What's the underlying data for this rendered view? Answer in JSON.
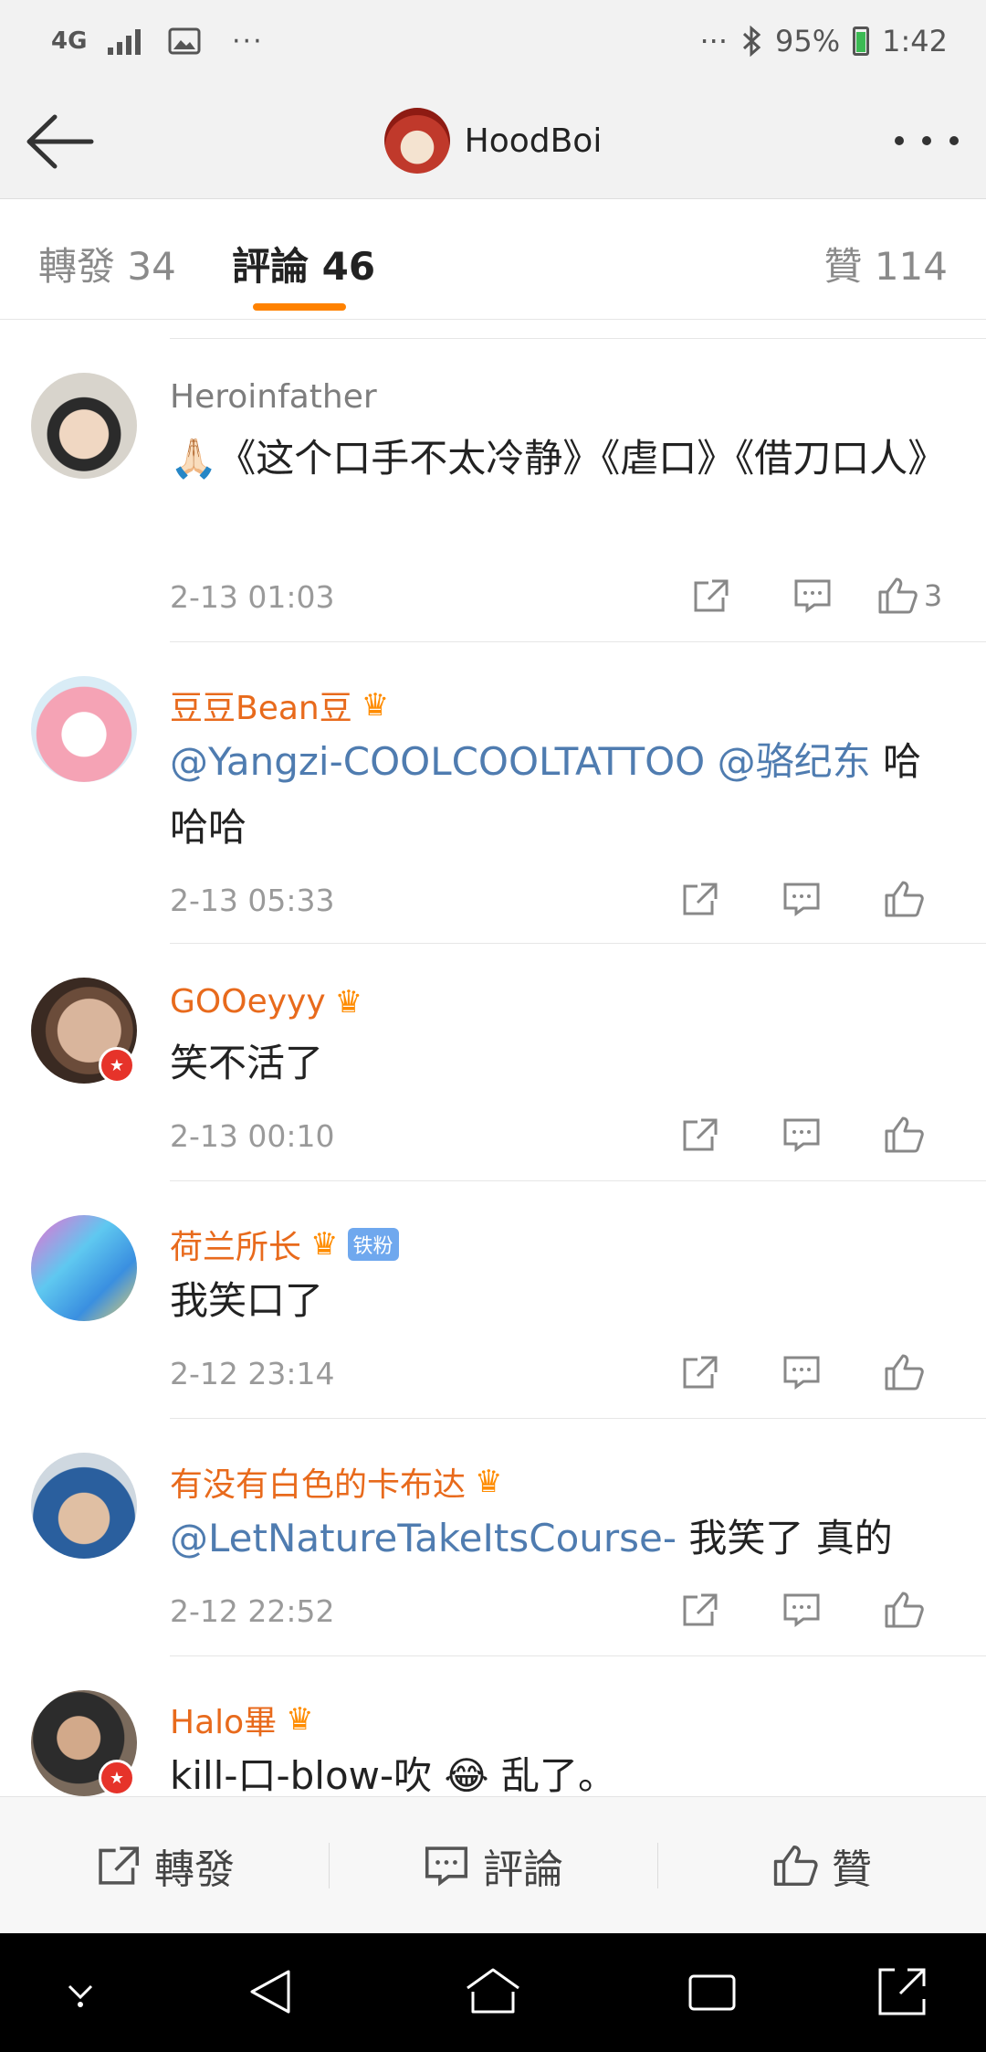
{
  "status_bar": {
    "network": "4G",
    "dots_left": "···",
    "dots_right": "···",
    "battery": "95%",
    "time": "1:42"
  },
  "header": {
    "title": "HoodBoi"
  },
  "tabs": [
    {
      "label": "轉發 34"
    },
    {
      "label": "評論 46"
    },
    {
      "label": "贊 114"
    }
  ],
  "comments": [
    {
      "name": "Heroinfather",
      "text": "🙏🏻《这个口手不太冷静》《虐口》《借刀口人》",
      "time": "2-13 01:03",
      "likes": "3",
      "verified": false
    },
    {
      "name": "豆豆Bean豆",
      "mention1": "@Yangzi-COOLCOOLTATTOO",
      "mention2": "@骆纪东",
      "text": "哈哈哈",
      "time": "2-13 05:33",
      "likes": "",
      "verified": false
    },
    {
      "name": "GOOeyyy",
      "text": "笑不活了",
      "time": "2-13 00:10",
      "likes": "",
      "verified": true
    },
    {
      "name": "荷兰所长",
      "badge": "铁粉",
      "text": "我笑口了",
      "time": "2-12 23:14",
      "likes": "",
      "verified": false
    },
    {
      "name": "有没有白色的卡布达",
      "mention1": "@LetNatureTakeItsCourse-",
      "text": "我笑了 真的",
      "time": "2-12 22:52",
      "likes": "",
      "verified": false
    },
    {
      "name": "Halo畢",
      "text": "kill-口-blow-吹",
      "emoji": "😂",
      "text2": "乱了。",
      "verified": true
    }
  ],
  "bottom_bar": {
    "repost": "轉發",
    "comment": "評論",
    "like": "贊"
  },
  "colors": {
    "accent": "#ff8200",
    "username": "#e86a1c",
    "mention": "#4f7cb0"
  }
}
